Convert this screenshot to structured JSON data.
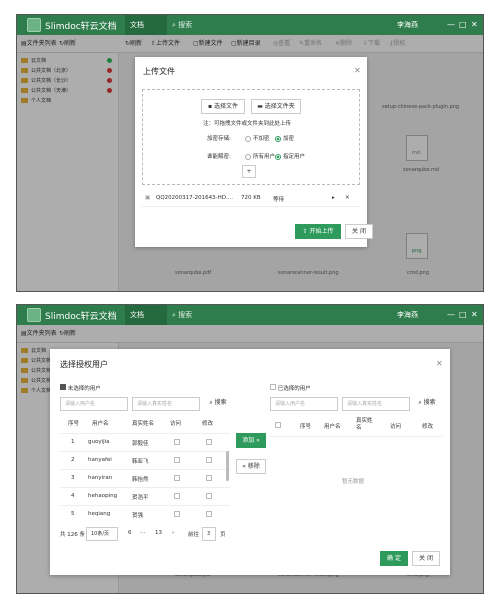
{
  "app": {
    "name": "Slimdoc轩云文档",
    "tab_doc": "文档",
    "search_placeholder": "搜索",
    "user": "李海燕"
  },
  "toolbar": {
    "folder_list": "文件夹列表",
    "refresh_left": "刷新",
    "refresh": "刷新",
    "upload": "上传文件",
    "new_doc": "新建文件",
    "new_dir": "新建目录",
    "view": "查看",
    "rename": "重命名",
    "delete": "删除",
    "download": "下载",
    "auth": "授权"
  },
  "sidebar": {
    "items": [
      {
        "label": "云文档",
        "dot": "#2ebd59"
      },
      {
        "label": "公共文档（北京）",
        "dot": "#e03a3a"
      },
      {
        "label": "公共文档（长沙）",
        "dot": "#e03a3a"
      },
      {
        "label": "公共文档（天津）",
        "dot": "#e03a3a"
      },
      {
        "label": "个人文档",
        "dot": ""
      }
    ]
  },
  "background_files": {
    "f1": "setup-chinese-pack-plugin.png",
    "f2": "md",
    "f3": "sonarqube.md",
    "f4": "png",
    "f5": "sonarqube.pdf",
    "f6": "sonarscanner-result.png",
    "f7": "cmd.png"
  },
  "upload_dialog": {
    "title": "上传文件",
    "choose_file": "选择文件",
    "choose_folder": "选择文件夹",
    "hint": "注：可拖拽文件或文件夹到此处上传",
    "encrypt_label": "加密存储:",
    "encrypt_no": "不加密",
    "encrypt_yes": "加密",
    "decrypt_label": "谁能解密:",
    "decrypt_all": "所有用户",
    "decrypt_specified": "指定用户",
    "add": "+",
    "file_name": "QQ20200317-201643-HD....",
    "file_size": "720 KB",
    "file_status": "等待",
    "start_upload": "开始上传",
    "close": "关 闭"
  },
  "grant_dialog": {
    "title": "选择授权用户",
    "left_title": "未选择的用户",
    "right_title": "已选择的用户",
    "username_placeholder": "请输入用户名",
    "realname_placeholder": "请输入真实姓名",
    "search": "搜索",
    "headers": [
      "序号",
      "用户名",
      "真实姓名",
      "访问",
      "修改"
    ],
    "rows": [
      [
        "1",
        "guoyijia",
        "郭毅佳"
      ],
      [
        "2",
        "hanyafei",
        "韩亚飞"
      ],
      [
        "3",
        "hanyiran",
        "韩怡然"
      ],
      [
        "4",
        "hehaoping",
        "贺浩平"
      ],
      [
        "5",
        "heqiang",
        "贺强"
      ]
    ],
    "right_headers": [
      "序号",
      "用户名",
      "真实姓名",
      "访问",
      "修改"
    ],
    "empty": "暂无数据",
    "add_btn": "添加 »",
    "remove_btn": "« 移除",
    "total": "共 126 条",
    "page_size": "10条/页",
    "page_cur": "6",
    "page_ellipsis": "···",
    "page_last": "13",
    "page_prev": "‹",
    "page_next": "›",
    "goto_label": "前往",
    "goto_value": "3",
    "goto_unit": "页",
    "ok": "确 定",
    "close": "关 闭"
  }
}
